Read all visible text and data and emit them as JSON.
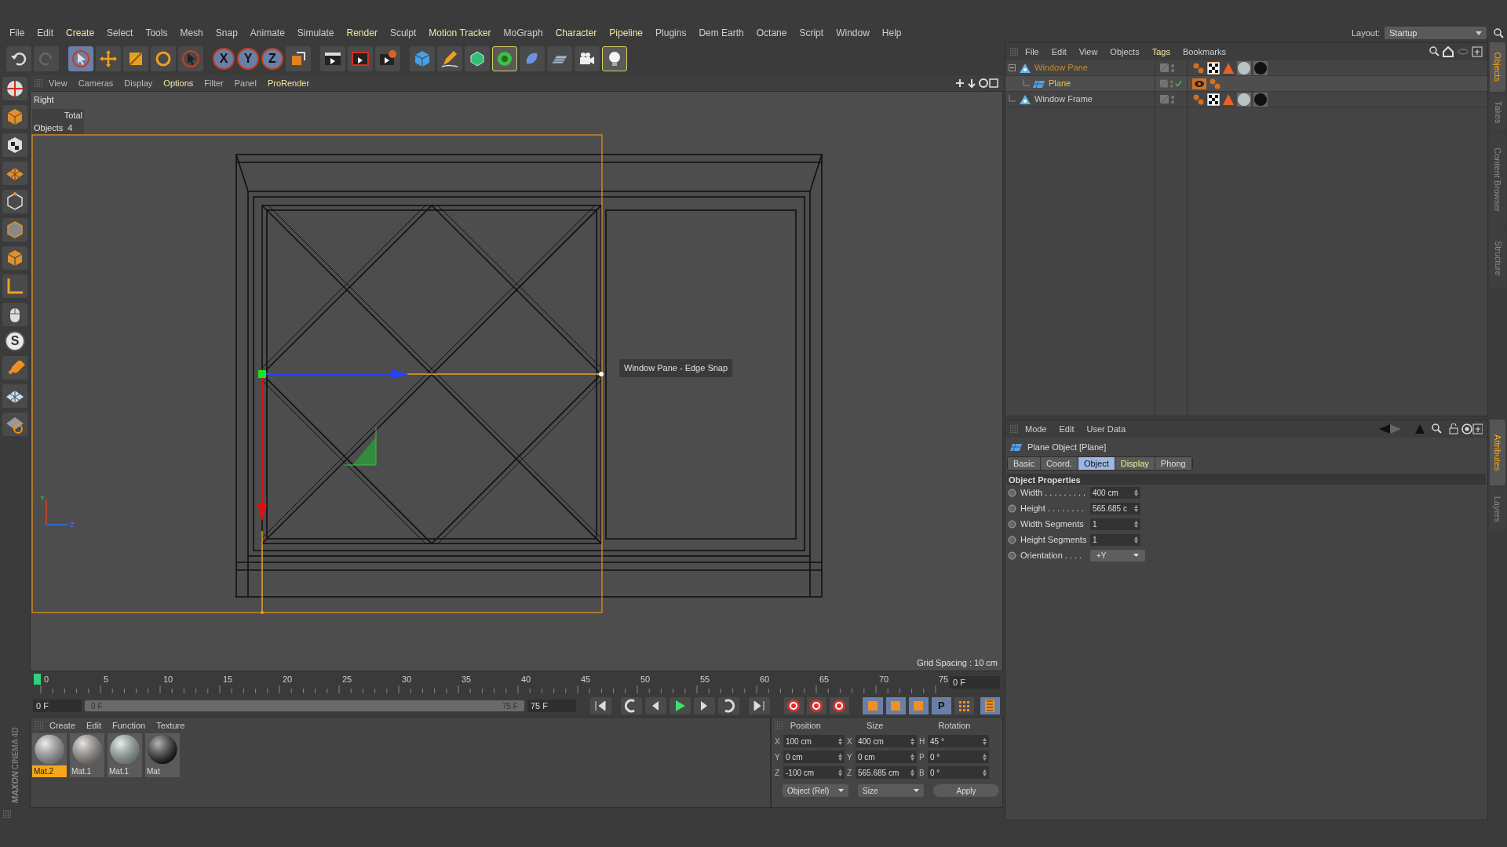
{
  "menu": [
    {
      "label": "File",
      "highlight": false
    },
    {
      "label": "Edit",
      "highlight": false
    },
    {
      "label": "Create",
      "highlight": true
    },
    {
      "label": "Select",
      "highlight": false
    },
    {
      "label": "Tools",
      "highlight": false
    },
    {
      "label": "Mesh",
      "highlight": false
    },
    {
      "label": "Snap",
      "highlight": false
    },
    {
      "label": "Animate",
      "highlight": false
    },
    {
      "label": "Simulate",
      "highlight": false
    },
    {
      "label": "Render",
      "highlight": true
    },
    {
      "label": "Sculpt",
      "highlight": false
    },
    {
      "label": "Motion Tracker",
      "highlight": true
    },
    {
      "label": "MoGraph",
      "highlight": false
    },
    {
      "label": "Character",
      "highlight": true
    },
    {
      "label": "Pipeline",
      "highlight": true
    },
    {
      "label": "Plugins",
      "highlight": false
    },
    {
      "label": "Dem Earth",
      "highlight": false
    },
    {
      "label": "Octane",
      "highlight": false
    },
    {
      "label": "Script",
      "highlight": false
    },
    {
      "label": "Window",
      "highlight": false
    },
    {
      "label": "Help",
      "highlight": false
    }
  ],
  "layout": {
    "label": "Layout:",
    "value": "Startup"
  },
  "toolbar": {
    "axis_buttons": [
      "X",
      "Y",
      "Z"
    ]
  },
  "left_tools": {
    "snap_label": "S"
  },
  "viewport": {
    "menu": [
      {
        "label": "View",
        "highlight": false
      },
      {
        "label": "Cameras",
        "highlight": false
      },
      {
        "label": "Display",
        "highlight": false
      },
      {
        "label": "Options",
        "highlight": true
      },
      {
        "label": "Filter",
        "highlight": false
      },
      {
        "label": "Panel",
        "highlight": false
      },
      {
        "label": "ProRender",
        "highlight": true
      }
    ],
    "view_name": "Right",
    "hud": {
      "header": "Total",
      "row_label": "Objects",
      "row_value": "4"
    },
    "tooltip": "Window Pane - Edge Snap",
    "axis_labels": [
      "Y",
      "Z"
    ],
    "grid_spacing": "Grid Spacing : 10 cm"
  },
  "timeline": {
    "ticks": [
      "0",
      "5",
      "10",
      "15",
      "20",
      "25",
      "30",
      "35",
      "40",
      "45",
      "50",
      "55",
      "60",
      "65",
      "70",
      "75"
    ],
    "playhead": {
      "level": 0
    },
    "current_frame": "0 F",
    "start_field": "0 F",
    "range_slider": {
      "level": 1,
      "start": "0 F",
      "end": "75 F"
    },
    "end_field": "75 F",
    "param_key_label": "P"
  },
  "material_manager": {
    "menu": [
      "Create",
      "Edit",
      "Function",
      "Texture"
    ],
    "materials": [
      {
        "name": "Mat.2",
        "selected": true,
        "color": "#c8c8c8"
      },
      {
        "name": "Mat.1",
        "selected": false,
        "color": "#b4aea6"
      },
      {
        "name": "Mat.1",
        "selected": false,
        "color": "#b8cccc"
      },
      {
        "name": "Mat",
        "selected": false,
        "color": "#0a0a0a"
      }
    ]
  },
  "logo": {
    "brand": "MAXON",
    "product": "CINEMA 4D"
  },
  "coordinates": {
    "headers": [
      "Position",
      "Size",
      "Rotation"
    ],
    "rows": [
      {
        "axis": "X",
        "position": "100 cm",
        "size_axis": "X",
        "size": "400 cm",
        "rot_axis": "H",
        "rotation": "45 °"
      },
      {
        "axis": "Y",
        "position": "0 cm",
        "size_axis": "Y",
        "size": "0 cm",
        "rot_axis": "P",
        "rotation": "0 °"
      },
      {
        "axis": "Z",
        "position": "-100 cm",
        "size_axis": "Z",
        "size": "565.685 cm",
        "rot_axis": "B",
        "rotation": "0 °"
      }
    ],
    "mode_dropdown": "Object (Rel)",
    "size_dropdown": "Size",
    "apply": "Apply"
  },
  "object_manager": {
    "menu": [
      {
        "label": "File",
        "highlight": false
      },
      {
        "label": "Edit",
        "highlight": false
      },
      {
        "label": "View",
        "highlight": false
      },
      {
        "label": "Objects",
        "highlight": false
      },
      {
        "label": "Tags",
        "highlight": true
      },
      {
        "label": "Bookmarks",
        "highlight": false
      }
    ],
    "objects": [
      {
        "name": "Window Pane",
        "kind": "null",
        "selected": false,
        "expanded": true,
        "check": false,
        "tags": [
          {
            "kind": "phong"
          },
          {
            "kind": "checker"
          },
          {
            "kind": "triangle"
          },
          {
            "kind": "sphere"
          },
          {
            "kind": "black"
          }
        ],
        "children": [
          {
            "name": "Plane",
            "kind": "plane",
            "selected": true,
            "check": true,
            "tags": [
              {
                "kind": "eye"
              },
              {
                "kind": "phong"
              }
            ]
          }
        ]
      },
      {
        "name": "Window Frame",
        "kind": "null",
        "selected": false,
        "check": false,
        "tags": [
          {
            "kind": "phong"
          },
          {
            "kind": "checker"
          },
          {
            "kind": "triangle"
          },
          {
            "kind": "sphere"
          },
          {
            "kind": "black"
          }
        ]
      }
    ]
  },
  "attributes": {
    "menu": [
      "Mode",
      "Edit",
      "User Data"
    ],
    "title": "Plane Object [Plane]",
    "tabs": [
      {
        "label": "Basic",
        "selected": false,
        "highlight": false
      },
      {
        "label": "Coord.",
        "selected": false,
        "highlight": false
      },
      {
        "label": "Object",
        "selected": true,
        "highlight": false
      },
      {
        "label": "Display",
        "selected": false,
        "highlight": true
      },
      {
        "label": "Phong",
        "selected": false,
        "highlight": false
      }
    ],
    "section": "Object Properties",
    "fields": [
      {
        "label": "Width . . . . . . . . .",
        "value": "400 cm",
        "kind": "number"
      },
      {
        "label": "Height . . . . . . . .",
        "value": "565.685 c",
        "kind": "number"
      },
      {
        "label": "Width Segments",
        "value": "1",
        "kind": "number"
      },
      {
        "label": "Height Segments",
        "value": "1",
        "kind": "number"
      },
      {
        "label": "Orientation . . . .",
        "value": "+Y",
        "kind": "dropdown"
      }
    ]
  },
  "side_tabs_top": [
    {
      "label": "Objects",
      "selected": true
    },
    {
      "label": "Takes",
      "selected": false
    },
    {
      "label": "Content Browser",
      "selected": false
    },
    {
      "label": "Structure",
      "selected": false
    }
  ],
  "side_tabs_bottom": [
    {
      "label": "Attributes",
      "selected": true
    },
    {
      "label": "Layers",
      "selected": false
    }
  ]
}
